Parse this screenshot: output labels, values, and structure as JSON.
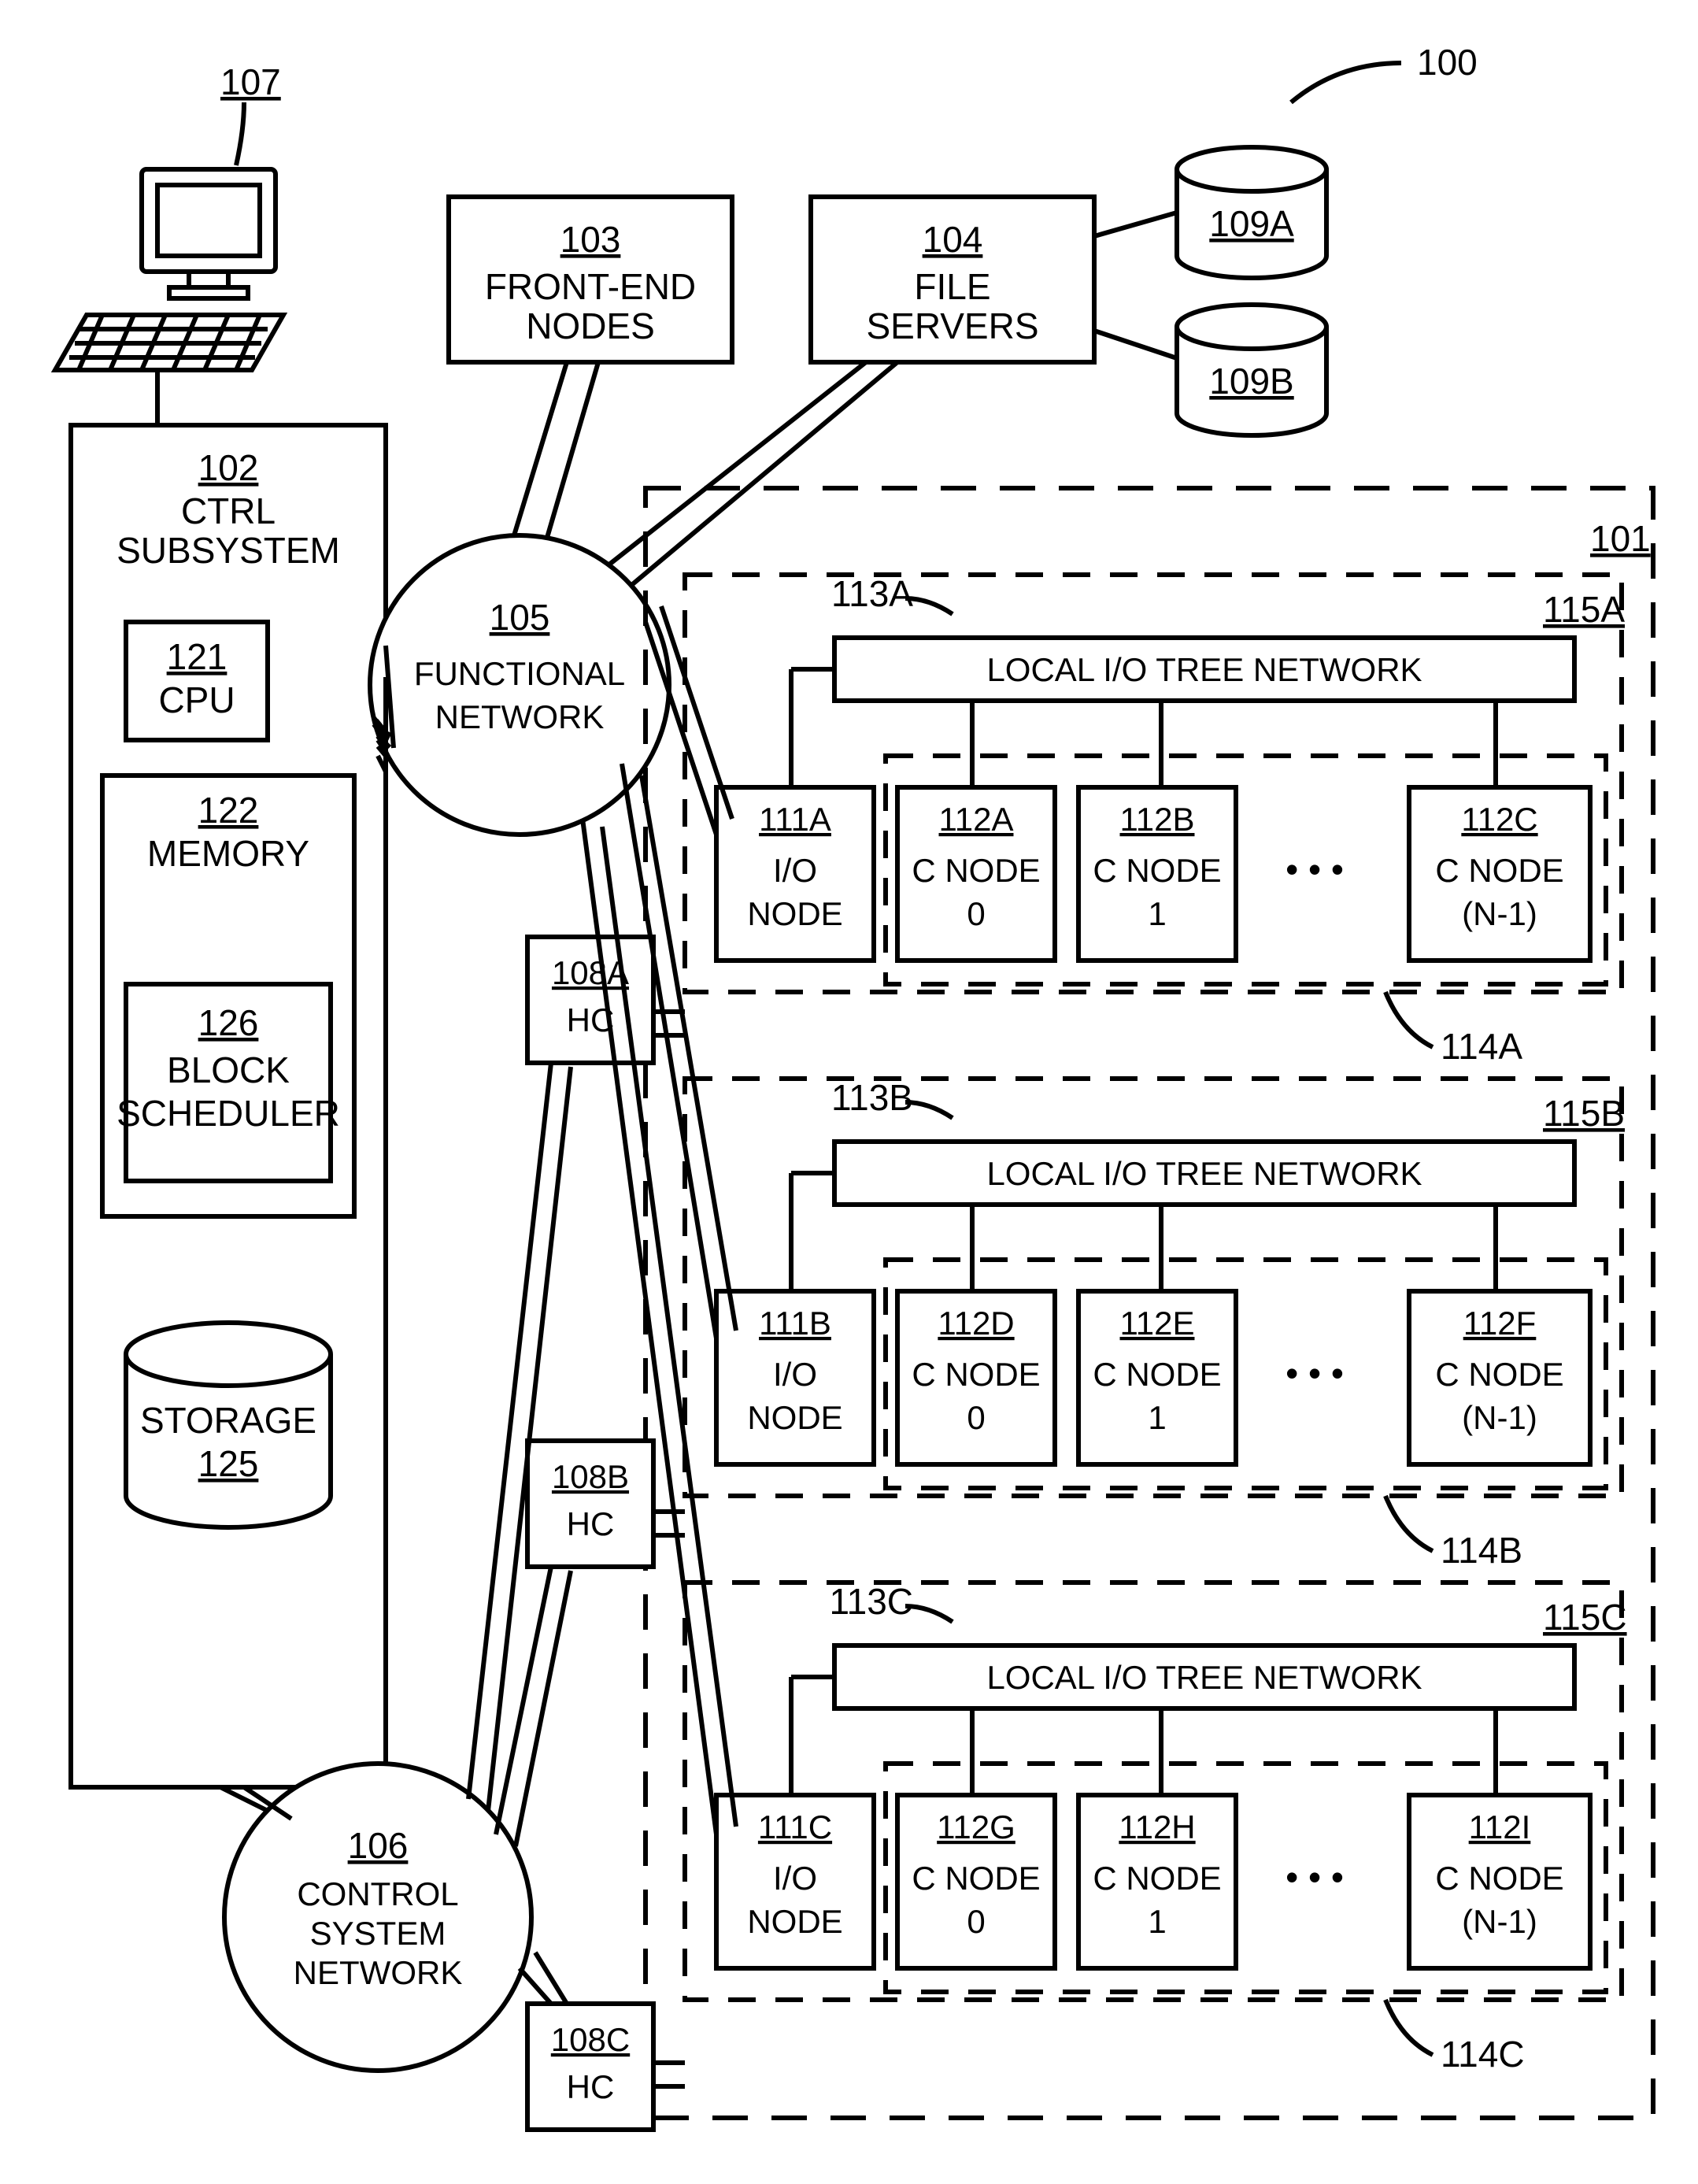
{
  "chart_data": null,
  "fig": {
    "ref100": "100"
  },
  "terminal": {
    "ref": "107"
  },
  "ctrl": {
    "ref": "102",
    "title": "CTRL\nSUBSYSTEM",
    "cpu": {
      "ref": "121",
      "label": "CPU"
    },
    "memory": {
      "ref": "122",
      "label": "MEMORY"
    },
    "scheduler": {
      "ref": "126",
      "label": "BLOCK\nSCHEDULER"
    },
    "storage": {
      "ref": "125",
      "label": "STORAGE"
    }
  },
  "frontend": {
    "ref": "103",
    "label": "FRONT-END\nNODES"
  },
  "fileservers": {
    "ref": "104",
    "label": "FILE\nSERVERS"
  },
  "disks": {
    "a": "109A",
    "b": "109B"
  },
  "func_net": {
    "ref": "105",
    "label": "FUNCTIONAL\nNETWORK"
  },
  "csn": {
    "ref": "106",
    "label": "CONTROL\nSYSTEM\nNETWORK"
  },
  "hc": {
    "a": {
      "ref": "108A",
      "label": "HC"
    },
    "b": {
      "ref": "108B",
      "label": "HC"
    },
    "c": {
      "ref": "108C",
      "label": "HC"
    }
  },
  "compute101": {
    "ref": "101"
  },
  "psets": [
    {
      "pset_ref": "115A",
      "torus_ref": "114A",
      "tree": {
        "ref": "113A",
        "label": "LOCAL I/O TREE NETWORK"
      },
      "nodes": [
        {
          "ref": "111A",
          "l1": "I/O",
          "l2": "NODE"
        },
        {
          "ref": "112A",
          "l1": "C NODE",
          "l2": "0"
        },
        {
          "ref": "112B",
          "l1": "C NODE",
          "l2": "1"
        },
        {
          "ref": "112C",
          "l1": "C NODE",
          "l2": "(N-1)"
        }
      ]
    },
    {
      "pset_ref": "115B",
      "torus_ref": "114B",
      "tree": {
        "ref": "113B",
        "label": "LOCAL I/O TREE NETWORK"
      },
      "nodes": [
        {
          "ref": "111B",
          "l1": "I/O",
          "l2": "NODE"
        },
        {
          "ref": "112D",
          "l1": "C NODE",
          "l2": "0"
        },
        {
          "ref": "112E",
          "l1": "C NODE",
          "l2": "1"
        },
        {
          "ref": "112F",
          "l1": "C NODE",
          "l2": "(N-1)"
        }
      ]
    },
    {
      "pset_ref": "115C",
      "torus_ref": "114C",
      "tree": {
        "ref": "113C",
        "label": "LOCAL I/O TREE NETWORK"
      },
      "nodes": [
        {
          "ref": "111C",
          "l1": "I/O",
          "l2": "NODE"
        },
        {
          "ref": "112G",
          "l1": "C NODE",
          "l2": "0"
        },
        {
          "ref": "112H",
          "l1": "C NODE",
          "l2": "1"
        },
        {
          "ref": "112I",
          "l1": "C NODE",
          "l2": "(N-1)"
        }
      ]
    }
  ],
  "dots": "• • •"
}
